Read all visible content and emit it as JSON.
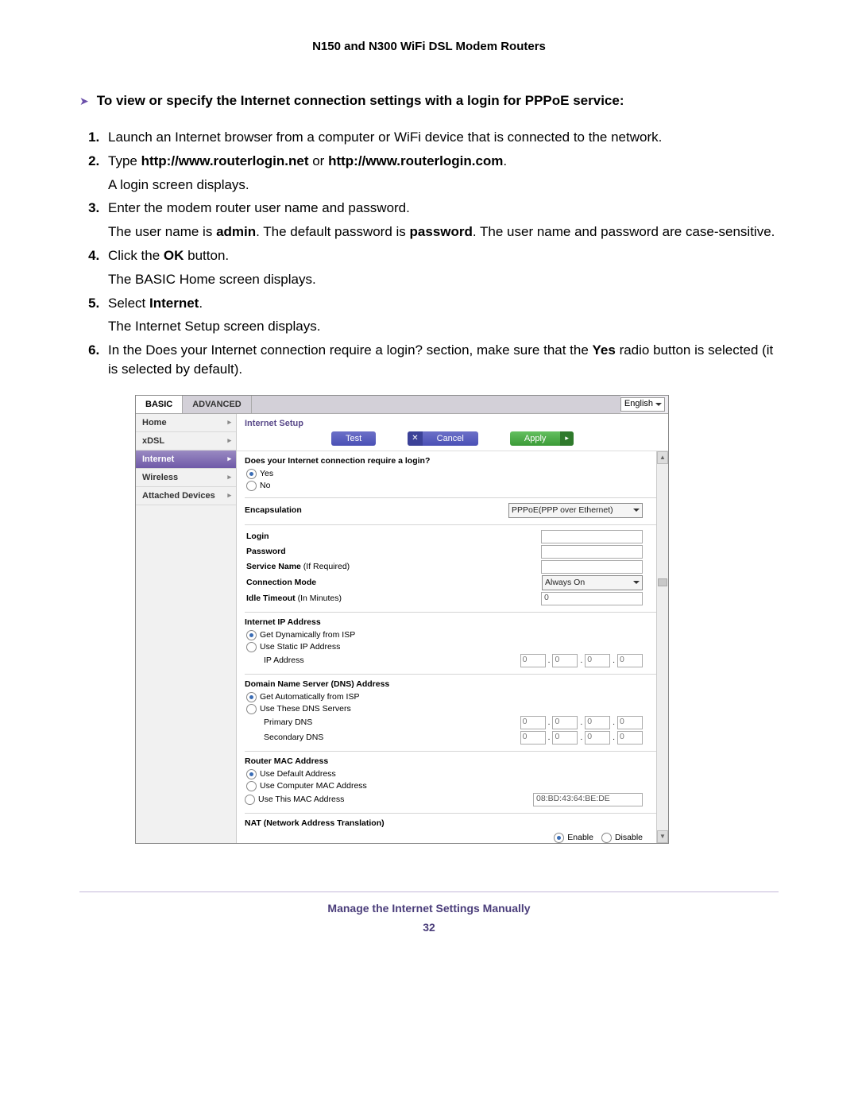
{
  "header": "N150 and N300 WiFi DSL Modem Routers",
  "heading": "To view or specify the Internet connection settings with a login for PPPoE service:",
  "steps": {
    "s1": "Launch an Internet browser from a computer or WiFi device that is connected to the network.",
    "s2a": "Type ",
    "s2b": "http://www.routerlogin.net",
    "s2c": " or ",
    "s2d": "http://www.routerlogin.com",
    "s2e": ".",
    "s2sub": "A login screen displays.",
    "s3": "Enter the modem router user name and password.",
    "s3sub_a": "The user name is ",
    "s3sub_b": "admin",
    "s3sub_c": ". The default password is ",
    "s3sub_d": "password",
    "s3sub_e": ". The user name and password are case-sensitive.",
    "s4a": "Click the ",
    "s4b": "OK",
    "s4c": " button.",
    "s4sub": "The BASIC Home screen displays.",
    "s5a": "Select ",
    "s5b": "Internet",
    "s5c": ".",
    "s5sub": "The Internet Setup screen displays.",
    "s6a": "In the Does your Internet connection require a login? section, make sure that the ",
    "s6b": "Yes",
    "s6c": " radio button is selected (it is selected by default)."
  },
  "shot": {
    "tabs": {
      "basic": "BASIC",
      "advanced": "ADVANCED"
    },
    "lang": "English",
    "nav": [
      "Home",
      "xDSL",
      "Internet",
      "Wireless",
      "Attached Devices"
    ],
    "title": "Internet Setup",
    "buttons": {
      "test": "Test",
      "cancel": "Cancel",
      "apply": "Apply"
    },
    "q": "Does your Internet connection require a login?",
    "yes": "Yes",
    "no": "No",
    "encap_l": "Encapsulation",
    "encap_v": "PPPoE(PPP over Ethernet)",
    "login_l": "Login",
    "password_l": "Password",
    "svc_a": "Service Name",
    "svc_b": " (If Required)",
    "conn_l": "Connection Mode",
    "conn_v": "Always On",
    "idle_a": "Idle Timeout",
    "idle_b": " (In Minutes)",
    "idle_v": "0",
    "ip_h": "Internet IP Address",
    "ip_dyn": "Get Dynamically from ISP",
    "ip_stat": "Use Static IP Address",
    "ip_addr_l": "IP Address",
    "dns_h": "Domain Name Server (DNS) Address",
    "dns_auto": "Get Automatically from ISP",
    "dns_use": "Use These DNS Servers",
    "dns_p": "Primary DNS",
    "dns_s": "Secondary DNS",
    "mac_h": "Router MAC Address",
    "mac_def": "Use Default Address",
    "mac_comp": "Use Computer MAC Address",
    "mac_this": "Use This MAC Address",
    "mac_v": "08:BD:43:64:BE:DE",
    "nat_h": "NAT (Network Address Translation)",
    "nat_e": "Enable",
    "nat_d": "Disable",
    "zero": "0"
  },
  "footer": {
    "title": "Manage the Internet Settings Manually",
    "page": "32"
  }
}
